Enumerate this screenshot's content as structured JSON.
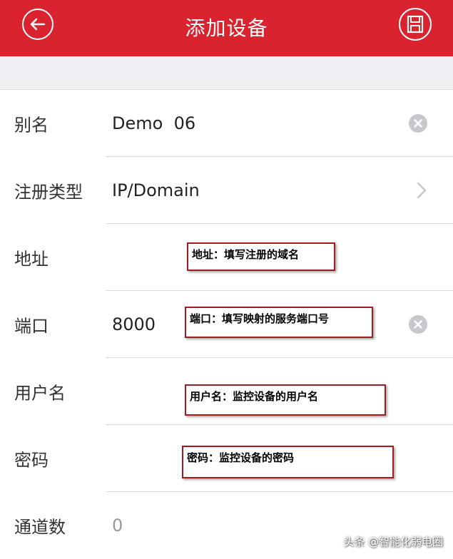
{
  "header": {
    "title": "添加设备",
    "back_icon": "back-arrow-icon",
    "save_icon": "save-icon",
    "background_color": "#d9232e"
  },
  "form": {
    "rows": [
      {
        "label": "别名",
        "value": "Demo  06",
        "action_icon": "clear-icon"
      },
      {
        "label": "注册类型",
        "value": "IP/Domain",
        "action_icon": "chevron-right-icon"
      },
      {
        "label": "地址",
        "value": ""
      },
      {
        "label": "端口",
        "value": "8000",
        "action_icon": "clear-icon"
      },
      {
        "label": "用户名",
        "value": ""
      },
      {
        "label": "密码",
        "value": ""
      },
      {
        "label": "通道数",
        "value": "0"
      }
    ]
  },
  "annotations": {
    "address": "地址：填写注册的域名",
    "port": "端口：填写映射的服务端口号",
    "username": "用户名：监控设备的用户名",
    "password": "密码：监控设备的密码",
    "border_color": "#a01c20"
  },
  "watermark": "头条 @智能化弱电圈"
}
